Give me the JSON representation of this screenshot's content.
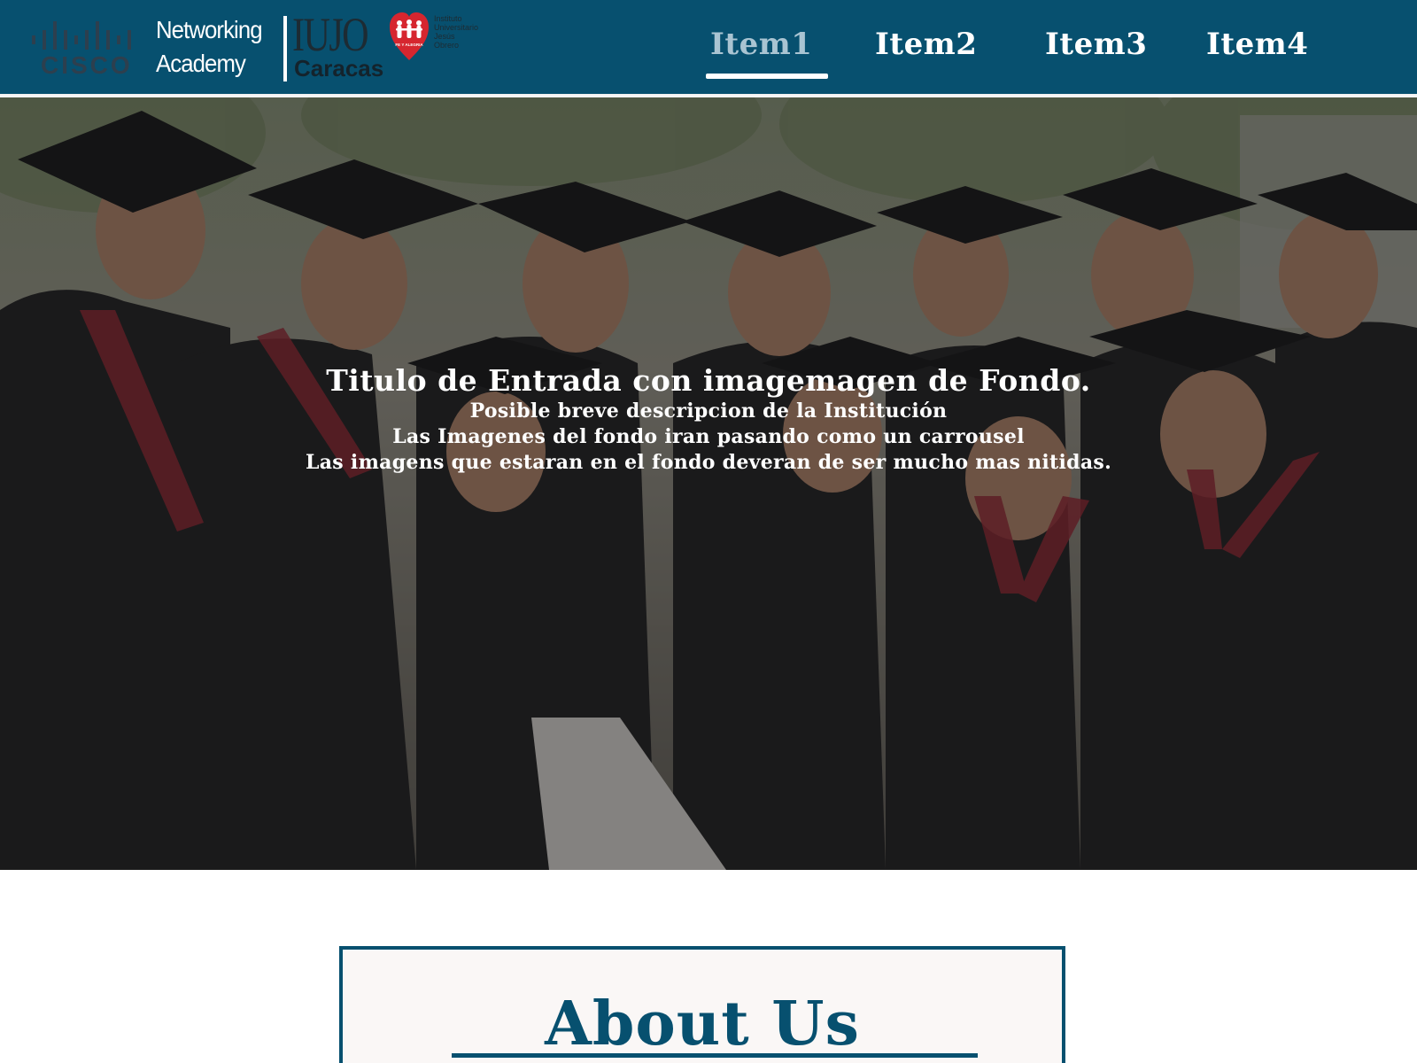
{
  "brand": {
    "cisco": "CISCO",
    "academy_line1": "Networking",
    "academy_line2": "Academy",
    "iujo": "IUJO",
    "city": "Caracas",
    "institute_lines": [
      "Instituto",
      "Universitario",
      "Jesús",
      "Obrero"
    ],
    "heart_caption": "FE Y ALEGRIA"
  },
  "nav": {
    "items": [
      {
        "label": "Item1",
        "active": true
      },
      {
        "label": "Item2",
        "active": false
      },
      {
        "label": "Item3",
        "active": false
      },
      {
        "label": "Item4",
        "active": false
      }
    ]
  },
  "hero": {
    "title": "Titulo de Entrada  con imagemagen de Fondo.",
    "lines": [
      "Posible breve descripcion de la Institución",
      "Las Imagenes del fondo iran pasando como un carrousel",
      "Las imagens que estaran en el fondo deveran de ser mucho mas nitidas."
    ]
  },
  "about": {
    "title": "About Us"
  },
  "colors": {
    "header_bg": "#07506f",
    "nav_active": "#a9c4d2",
    "about_accent": "#07506f",
    "heart_red": "#d6262f"
  },
  "icons": {
    "cisco_logo": "cisco-bars-icon",
    "heart_logo": "heart-children-icon"
  }
}
